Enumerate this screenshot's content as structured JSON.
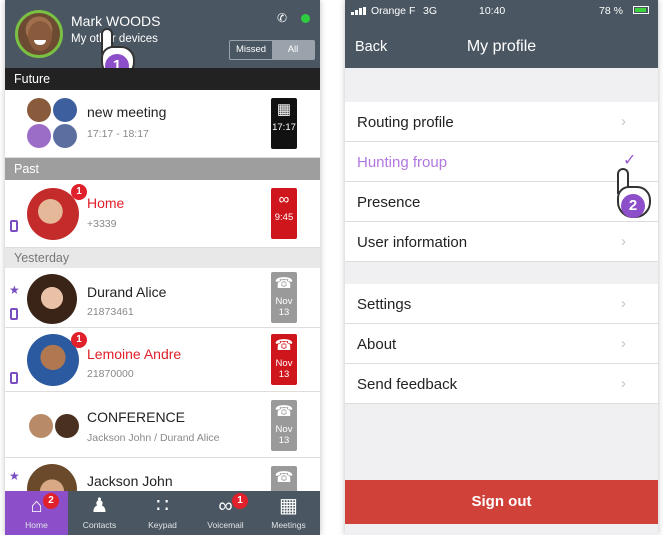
{
  "left_phone": {
    "header": {
      "user_name": "Mark WOODS",
      "subtitle": "My other devices",
      "filter_missed": "Missed",
      "filter_all": "All",
      "status_color": "#2ecc40"
    },
    "sections": {
      "future": "Future",
      "past": "Past",
      "yesterday": "Yesterday"
    },
    "rows": [
      {
        "title": "new meeting",
        "subtitle": "17:17 - 18:17",
        "tile_label": "17:17",
        "tile_icon": "calendar-icon"
      },
      {
        "title": "Home",
        "subtitle": "+3339",
        "tile_label": "9:45",
        "tile_icon": "voicemail-icon",
        "badge": "1"
      },
      {
        "title": "Durand Alice",
        "subtitle": "21873461",
        "tile_month": "Nov",
        "tile_day": "13",
        "tile_icon": "phone-icon"
      },
      {
        "title": "Lemoine Andre",
        "subtitle": "21870000",
        "tile_month": "Nov",
        "tile_day": "13",
        "tile_icon": "phone-icon",
        "badge": "1"
      },
      {
        "title": "CONFERENCE",
        "subtitle": "Jackson John / Durand Alice",
        "tile_month": "Nov",
        "tile_day": "13",
        "tile_icon": "phone-icon"
      },
      {
        "title": "Jackson John",
        "tile_icon": "phone-icon"
      }
    ],
    "tabs": [
      {
        "label": "Home",
        "badge": "2"
      },
      {
        "label": "Contacts"
      },
      {
        "label": "Keypad"
      },
      {
        "label": "Voicemail",
        "badge": "1"
      },
      {
        "label": "Meetings"
      }
    ],
    "step_number": "1"
  },
  "right_phone": {
    "status_bar": {
      "carrier": "Orange F",
      "network": "3G",
      "time": "10:40",
      "battery": "78 %"
    },
    "nav": {
      "back_label": "Back",
      "title": "My profile"
    },
    "menu_group_1": [
      {
        "label": "Routing profile"
      },
      {
        "label": "Hunting froup",
        "checked": true
      },
      {
        "label": "Presence"
      },
      {
        "label": "User information"
      }
    ],
    "menu_group_2": [
      {
        "label": "Settings"
      },
      {
        "label": "About"
      },
      {
        "label": "Send feedback"
      }
    ],
    "sign_out_label": "Sign out",
    "step_number": "2"
  },
  "colors": {
    "header_bg": "#4a5661",
    "accent_purple": "#8c4fc9",
    "missed_red": "#e0202a",
    "signout_red": "#d0413a"
  }
}
